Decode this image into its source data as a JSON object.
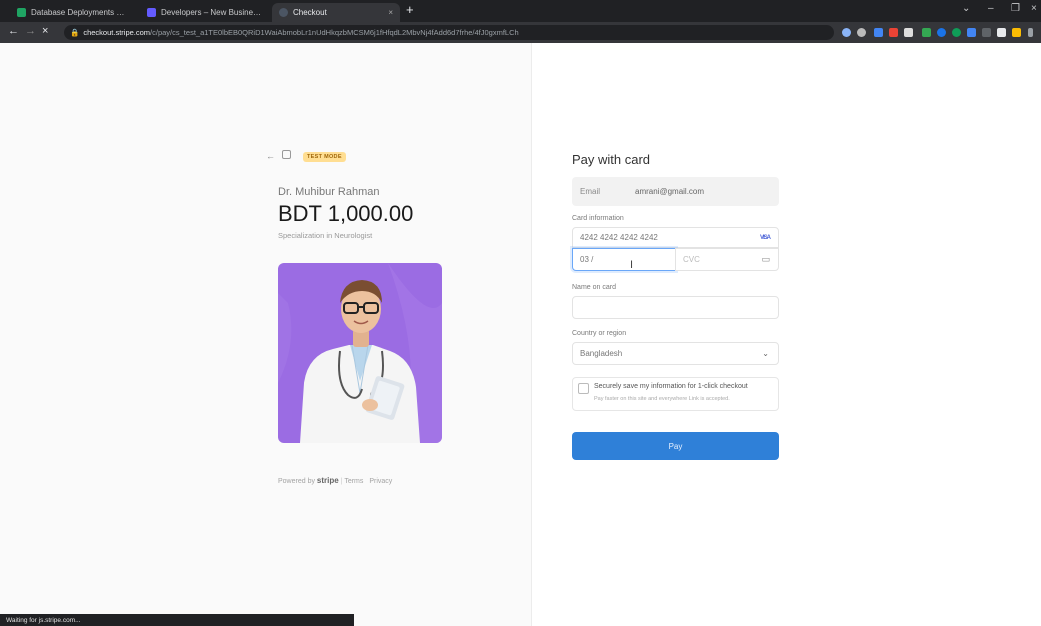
{
  "browser": {
    "tabs": [
      {
        "label": "Database Deployments | Cloud: ×",
        "favicon_color": "#1fa463"
      },
      {
        "label": "Developers – New Business – St ×",
        "favicon_color": "#635bff"
      },
      {
        "label": "Checkout",
        "favicon_color": "#4b5563"
      }
    ],
    "active_tab_close": "×",
    "new_tab": "+",
    "window_controls": {
      "minimize": "–",
      "maximize": "❐",
      "close": "×",
      "tab_search": "⌄"
    },
    "nav": {
      "back": "←",
      "forward": "→",
      "stop": "×"
    },
    "url_host": "checkout.stripe.com",
    "url_path": "/c/pay/cs_test_a1TE0lbEB0QRiD1WaiAbmobLr1nUdHkqzbMCSM6j1fHfqdL2MbvNj4fAdd6d7frhe/4fJ0gxmfLCh"
  },
  "left": {
    "back_icon": "arrow-left-icon",
    "test_mode_badge": "TEST MODE",
    "product_name": "Dr. Muhibur Rahman",
    "price": "BDT 1,000.00",
    "description": "Specialization in Neurologist",
    "image_alt": "doctor-photo",
    "footer": {
      "powered_by": "Powered by",
      "brand": "stripe",
      "terms": "Terms",
      "privacy": "Privacy"
    }
  },
  "form": {
    "title": "Pay with card",
    "email_label": "Email",
    "email_value": "amrani@gmail.com",
    "card_label": "Card information",
    "card_number": "4242 4242 4242 4242",
    "card_brand": "VISA",
    "expiry_value": "03 /",
    "cvc_placeholder": "CVC",
    "name_label": "Name on card",
    "country_label": "Country or region",
    "country_value": "Bangladesh",
    "save_title": "Securely save my information for 1-click checkout",
    "save_subtitle": "Pay faster on this site and everywhere Link is accepted.",
    "pay_button": "Pay"
  },
  "status_bar": "Waiting for js.stripe.com..."
}
